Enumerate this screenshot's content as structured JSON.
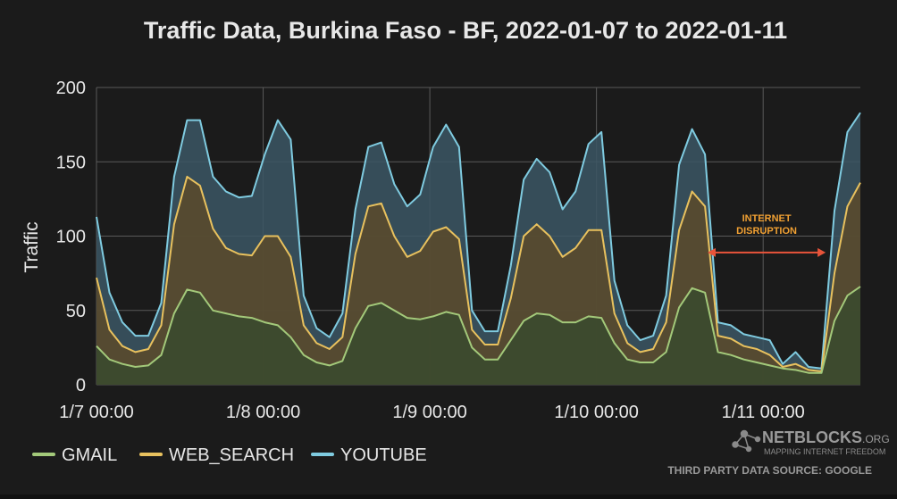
{
  "colors": {
    "background": "#1b1b1b",
    "grid": "#5a5a5a",
    "text": "#e8e8e8",
    "gmail": "#a3c97a",
    "web_search": "#e8c15e",
    "youtube": "#7fcbe0",
    "annotation": "#e8543a",
    "annotation_text": "#f0a033"
  },
  "footer": {
    "logo_text": "NETBLOCKS",
    "logo_suffix": ".ORG",
    "logo_tagline": "MAPPING INTERNET FREEDOM",
    "logo_icon": "network-nodes-icon",
    "source": "THIRD PARTY DATA SOURCE: GOOGLE"
  },
  "chart_data": {
    "type": "area",
    "title": "Traffic Data, Burkina Faso - BF, 2022-01-07 to 2022-01-11",
    "xlabel": "",
    "ylabel": "Traffic",
    "ylim": [
      0,
      200
    ],
    "yticks": [
      0,
      50,
      100,
      150,
      200
    ],
    "xlim": [
      "2022-01-07 00:00",
      "2022-01-11 14:00"
    ],
    "xticks": [
      "1/7 00:00",
      "1/8 00:00",
      "1/9 00:00",
      "1/10 00:00",
      "1/11 00:00"
    ],
    "grid": true,
    "legend_position": "bottom-left",
    "stacked": false,
    "annotation": {
      "text_lines": [
        "INTERNET",
        "DISRUPTION"
      ],
      "from": "2022-01-10 16:00",
      "to": "2022-01-11 09:00",
      "y": 89
    },
    "x": [
      "2022-01-07 00:00",
      "2022-01-07 02:00",
      "2022-01-07 04:00",
      "2022-01-07 06:00",
      "2022-01-07 08:00",
      "2022-01-07 10:00",
      "2022-01-07 12:00",
      "2022-01-07 14:00",
      "2022-01-07 16:00",
      "2022-01-07 18:00",
      "2022-01-07 20:00",
      "2022-01-07 22:00",
      "2022-01-08 00:00",
      "2022-01-08 02:00",
      "2022-01-08 04:00",
      "2022-01-08 06:00",
      "2022-01-08 08:00",
      "2022-01-08 10:00",
      "2022-01-08 12:00",
      "2022-01-08 14:00",
      "2022-01-08 16:00",
      "2022-01-08 18:00",
      "2022-01-08 20:00",
      "2022-01-08 22:00",
      "2022-01-09 00:00",
      "2022-01-09 02:00",
      "2022-01-09 04:00",
      "2022-01-09 06:00",
      "2022-01-09 08:00",
      "2022-01-09 10:00",
      "2022-01-09 12:00",
      "2022-01-09 14:00",
      "2022-01-09 16:00",
      "2022-01-09 18:00",
      "2022-01-09 20:00",
      "2022-01-09 22:00",
      "2022-01-10 00:00",
      "2022-01-10 02:00",
      "2022-01-10 04:00",
      "2022-01-10 06:00",
      "2022-01-10 08:00",
      "2022-01-10 10:00",
      "2022-01-10 12:00",
      "2022-01-10 14:00",
      "2022-01-10 16:00",
      "2022-01-10 18:00",
      "2022-01-10 20:00",
      "2022-01-10 22:00",
      "2022-01-11 00:00",
      "2022-01-11 02:00",
      "2022-01-11 04:00",
      "2022-01-11 06:00",
      "2022-01-11 08:00",
      "2022-01-11 10:00",
      "2022-01-11 12:00",
      "2022-01-11 14:00"
    ],
    "series": [
      {
        "name": "YOUTUBE",
        "values": [
          113,
          62,
          42,
          33,
          33,
          55,
          140,
          178,
          178,
          140,
          130,
          126,
          127,
          155,
          178,
          165,
          60,
          38,
          32,
          48,
          118,
          160,
          163,
          135,
          120,
          128,
          160,
          175,
          160,
          50,
          36,
          36,
          80,
          138,
          152,
          143,
          118,
          130,
          162,
          170,
          70,
          40,
          30,
          33,
          60,
          148,
          172,
          155,
          42,
          40,
          34,
          32,
          30,
          14,
          22,
          12,
          11,
          117,
          170,
          183
        ]
      },
      {
        "name": "WEB_SEARCH",
        "values": [
          72,
          37,
          26,
          22,
          24,
          40,
          108,
          140,
          134,
          105,
          92,
          88,
          87,
          100,
          100,
          86,
          40,
          28,
          24,
          32,
          88,
          120,
          122,
          100,
          86,
          90,
          103,
          106,
          98,
          37,
          27,
          27,
          58,
          100,
          108,
          100,
          86,
          92,
          104,
          104,
          48,
          28,
          22,
          24,
          42,
          104,
          130,
          120,
          33,
          31,
          26,
          24,
          20,
          12,
          14,
          10,
          9,
          75,
          120,
          136
        ]
      },
      {
        "name": "GMAIL",
        "values": [
          26,
          17,
          14,
          12,
          13,
          20,
          48,
          64,
          62,
          50,
          48,
          46,
          45,
          42,
          40,
          32,
          20,
          15,
          13,
          16,
          38,
          53,
          55,
          50,
          45,
          44,
          46,
          49,
          47,
          25,
          17,
          17,
          30,
          43,
          48,
          47,
          42,
          42,
          46,
          45,
          28,
          17,
          15,
          15,
          22,
          52,
          65,
          62,
          22,
          20,
          17,
          15,
          13,
          11,
          10,
          8,
          8,
          43,
          60,
          66
        ]
      }
    ]
  }
}
